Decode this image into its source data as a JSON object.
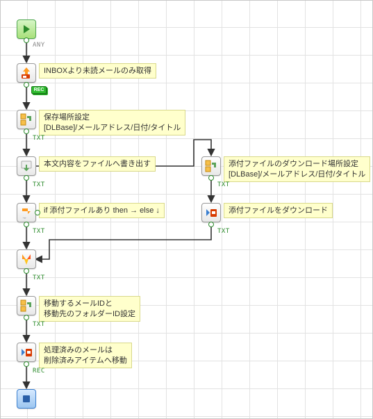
{
  "nodes": {
    "start": {
      "label": ""
    },
    "fetch_mail": {
      "label": "INBOXより未読メールのみ取得"
    },
    "save_loc": {
      "label_l1": "保存場所設定",
      "label_l2": "[DLBase]/メールアドレス/日付/タイトル"
    },
    "write_body": {
      "label": "本文内容をファイルへ書き出す"
    },
    "if_attach": {
      "label": "if 添付ファイルあり then → else ↓"
    },
    "dl_loc": {
      "label_l1": "添付ファイルのダウンロード場所設定",
      "label_l2": "[DLBase]/メールアドレス/日付/タイトル"
    },
    "dl_attach": {
      "label": "添付ファイルをダウンロード"
    },
    "merge": {
      "label": ""
    },
    "move_ids": {
      "label_l1": "移動するメールIDと",
      "label_l2": "移動先のフォルダーID設定"
    },
    "move_done": {
      "label_l1": "処理済みのメールは",
      "label_l2": "削除済みアイテムへ移動"
    },
    "end": {
      "label": ""
    }
  },
  "ports": {
    "any": "ANY",
    "txt": "TXT",
    "rec": "REC"
  }
}
